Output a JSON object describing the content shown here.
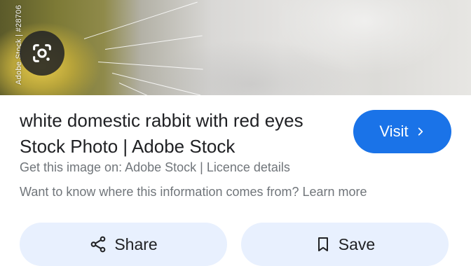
{
  "image": {
    "side_watermark": "Adobe Stock | #28706",
    "lens_icon": "google-lens-icon"
  },
  "result": {
    "title": "white domestic rabbit with red eyes Stock Photo | Adobe Stock",
    "source_prefix": "Get this image on: ",
    "source_name": "Adobe Stock",
    "separator": " | ",
    "licence_label": "Licence details",
    "info_question": "Want to know where this information comes from? ",
    "learn_more_label": "Learn more"
  },
  "buttons": {
    "visit_label": "Visit",
    "share_label": "Share",
    "save_label": "Save"
  },
  "colors": {
    "accent": "#1a73e8",
    "pill_bg": "#e8f0fe",
    "text_primary": "#202124",
    "text_secondary": "#70757a"
  }
}
